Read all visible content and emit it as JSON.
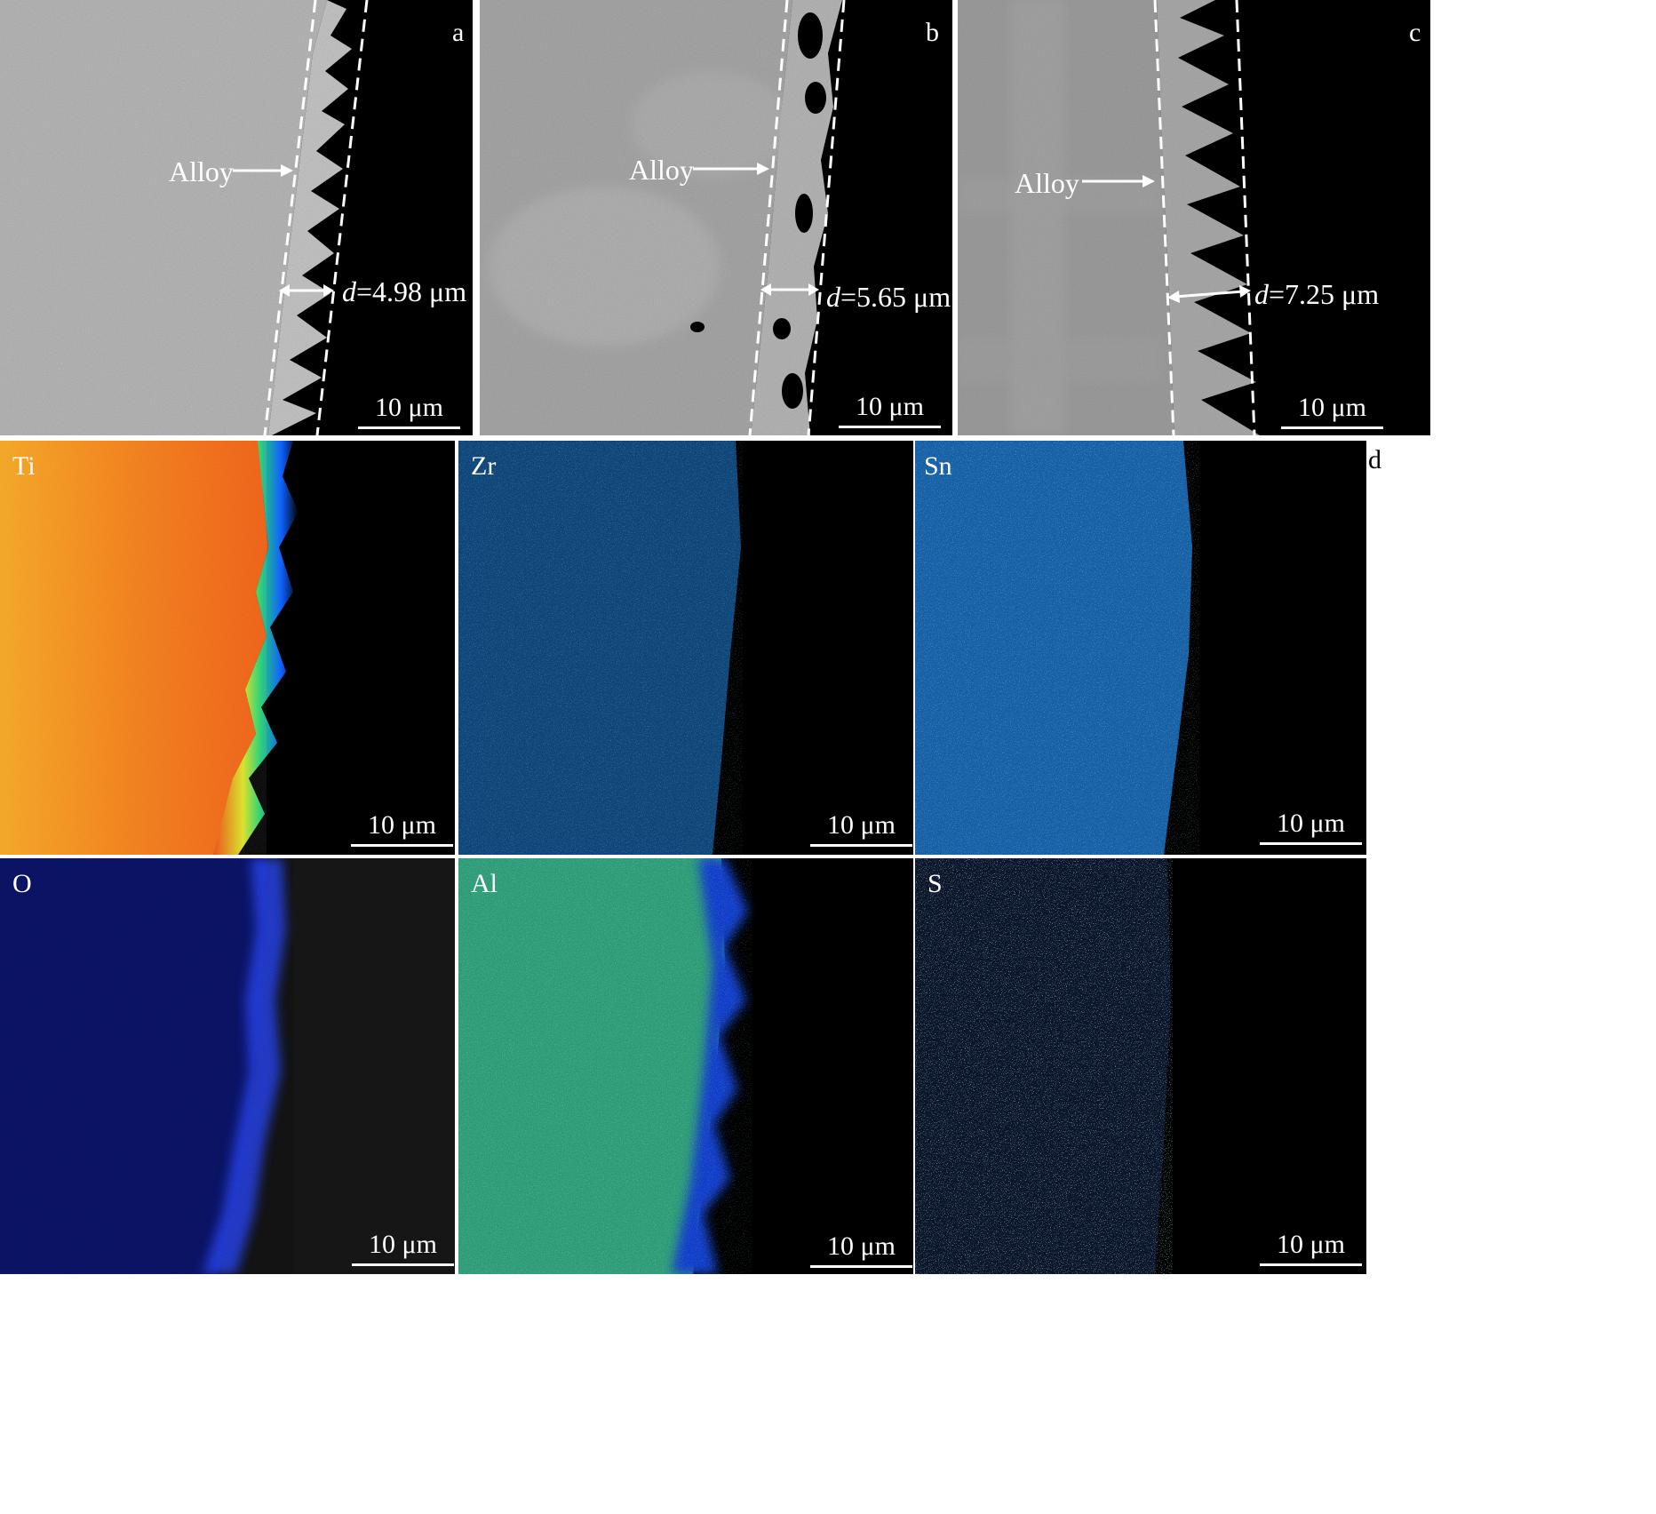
{
  "sem_panels": [
    {
      "letter": "a",
      "alloy_label": "Alloy",
      "d_symbol": "d",
      "d_value": "=4.98 μm",
      "scale_label": "10 μm"
    },
    {
      "letter": "b",
      "alloy_label": "Alloy",
      "d_symbol": "d",
      "d_value": "=5.65 μm",
      "scale_label": "10 μm"
    },
    {
      "letter": "c",
      "alloy_label": "Alloy",
      "d_symbol": "d",
      "d_value": "=7.25 μm",
      "scale_label": "10 μm"
    }
  ],
  "eds_group_letter": "d",
  "eds_maps": [
    {
      "element": "Ti",
      "scale_label": "10 μm"
    },
    {
      "element": "Zr",
      "scale_label": "10 μm"
    },
    {
      "element": "Sn",
      "scale_label": "10 μm"
    },
    {
      "element": "O",
      "scale_label": "10 μm"
    },
    {
      "element": "Al",
      "scale_label": "10 μm"
    },
    {
      "element": "S",
      "scale_label": "10 μm"
    }
  ]
}
